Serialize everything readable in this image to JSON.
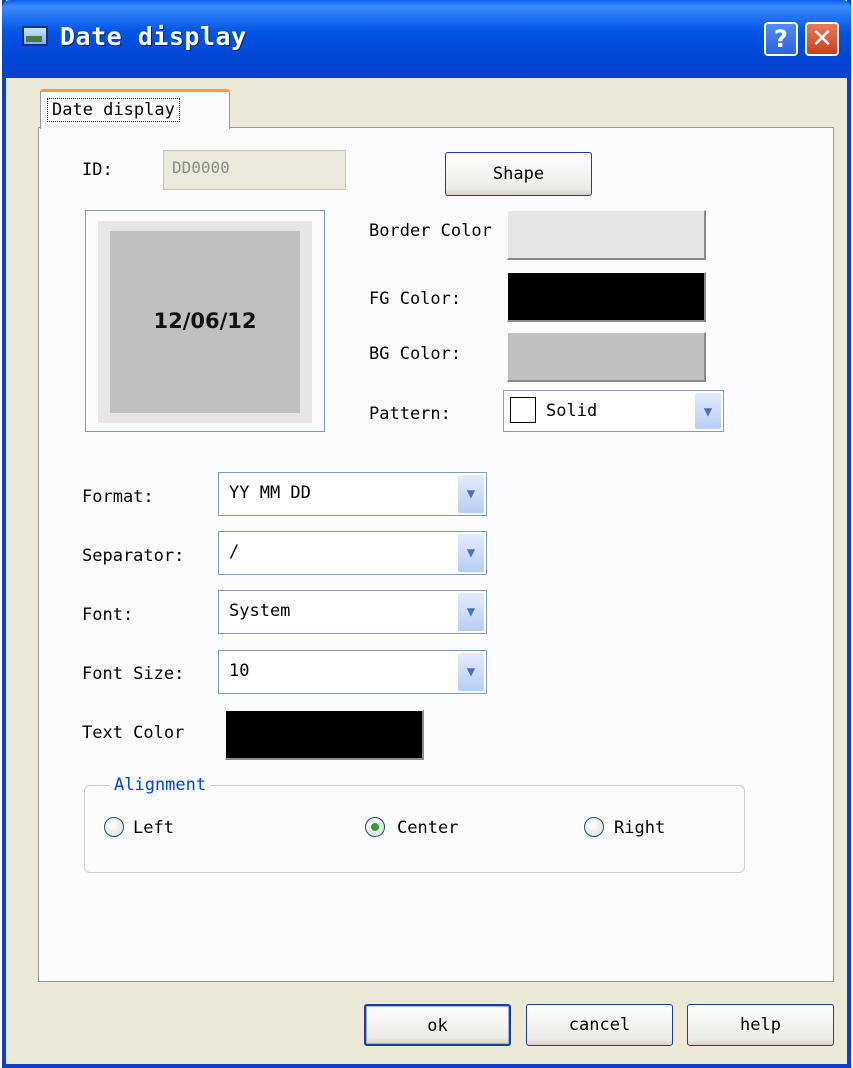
{
  "window": {
    "title": "Date display",
    "help_button": "?",
    "close_button": "✕"
  },
  "tab": {
    "label": "Date display"
  },
  "id_label": "ID:",
  "id_value": "DD0000",
  "shape_button": "Shape",
  "preview": {
    "text": "12/06/12",
    "border_color": "#e6e6e6",
    "background_color": "#c0c0c0"
  },
  "colors": {
    "border_label": "Border Color",
    "border_value": "#e6e6e6",
    "fg_label": "FG Color:",
    "fg_value": "#000000",
    "bg_label": "BG Color:",
    "bg_value": "#c0c0c0"
  },
  "pattern": {
    "label": "Pattern:",
    "value": "Solid"
  },
  "format": {
    "label": "Format:",
    "value": "YY MM DD"
  },
  "separator": {
    "label": "Separator:",
    "value": "/"
  },
  "font": {
    "label": "Font:",
    "value": "System"
  },
  "font_size": {
    "label": "Font Size:",
    "value": "10"
  },
  "text_color": {
    "label": "Text Color",
    "value": "#000000"
  },
  "alignment": {
    "legend": "Alignment",
    "left": "Left",
    "center": "Center",
    "right": "Right",
    "selected": "Center"
  },
  "buttons": {
    "ok": "ok",
    "cancel": "cancel",
    "help": "help"
  }
}
